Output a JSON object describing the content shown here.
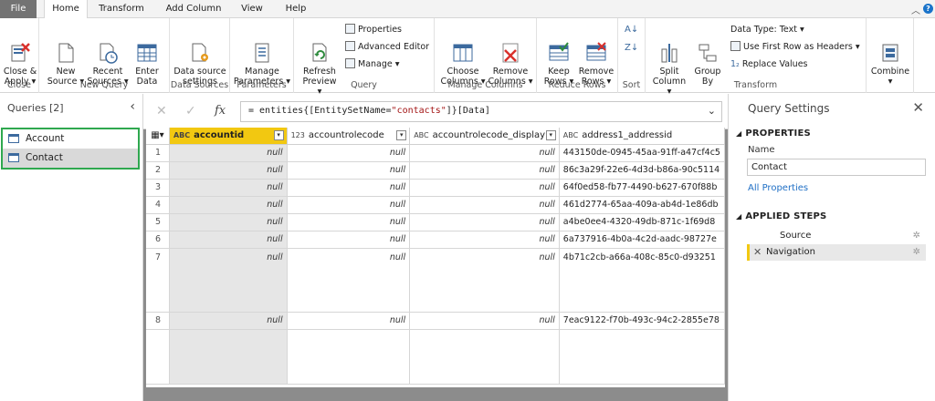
{
  "tabs": [
    "File",
    "Home",
    "Transform",
    "Add Column",
    "View",
    "Help"
  ],
  "active_tab": "Home",
  "ribbon": {
    "close_group": {
      "label": "Close",
      "close_apply": "Close &\nApply ▾"
    },
    "new_query_group": {
      "label": "New Query",
      "new_source": "New\nSource ▾",
      "recent_sources": "Recent\nSources ▾",
      "enter_data": "Enter\nData"
    },
    "data_sources_group": {
      "label": "Data Sources",
      "data_source_settings": "Data source\nsettings"
    },
    "parameters_group": {
      "label": "Parameters",
      "manage_parameters": "Manage\nParameters ▾"
    },
    "query_group": {
      "label": "Query",
      "refresh_preview": "Refresh\nPreview ▾",
      "properties": "Properties",
      "advanced_editor": "Advanced Editor",
      "manage": "Manage ▾"
    },
    "manage_columns_group": {
      "label": "Manage Columns",
      "choose_columns": "Choose\nColumns ▾",
      "remove_columns": "Remove\nColumns ▾"
    },
    "reduce_rows_group": {
      "label": "Reduce Rows",
      "keep_rows": "Keep\nRows ▾",
      "remove_rows": "Remove\nRows ▾"
    },
    "sort_group": {
      "label": "Sort"
    },
    "transform_group": {
      "label": "Transform",
      "split_column": "Split\nColumn ▾",
      "group_by": "Group\nBy",
      "data_type": "Data Type: Text ▾",
      "first_row_headers": "Use First Row as Headers ▾",
      "replace_values": "Replace Values"
    },
    "combine_group": {
      "label": "",
      "combine": "Combine\n▾"
    }
  },
  "queries": {
    "title": "Queries [2]",
    "items": [
      "Account",
      "Contact"
    ],
    "selected": "Contact"
  },
  "formula": {
    "prefix": "= entities{[EntitySetName=",
    "string": "\"contacts\"",
    "suffix": "]}[Data]"
  },
  "grid": {
    "columns": [
      {
        "type": "ABC",
        "name": "accountid"
      },
      {
        "type": "123",
        "name": "accountrolecode"
      },
      {
        "type": "ABC",
        "name": "accountrolecode_display"
      },
      {
        "type": "ABC",
        "name": "address1_addressid"
      }
    ],
    "rows": [
      {
        "n": "1",
        "c1": "null",
        "c2": "null",
        "c3": "null",
        "c4": "443150de-0945-45aa-91ff-a47cf4c5"
      },
      {
        "n": "2",
        "c1": "null",
        "c2": "null",
        "c3": "null",
        "c4": "86c3a29f-22e6-4d3d-b86a-90c5114"
      },
      {
        "n": "3",
        "c1": "null",
        "c2": "null",
        "c3": "null",
        "c4": "64f0ed58-fb77-4490-b627-670f88b"
      },
      {
        "n": "4",
        "c1": "null",
        "c2": "null",
        "c3": "null",
        "c4": "461d2774-65aa-409a-ab4d-1e86db"
      },
      {
        "n": "5",
        "c1": "null",
        "c2": "null",
        "c3": "null",
        "c4": "a4be0ee4-4320-49db-871c-1f69d8"
      },
      {
        "n": "6",
        "c1": "null",
        "c2": "null",
        "c3": "null",
        "c4": "6a737916-4b0a-4c2d-aadc-98727e"
      },
      {
        "n": "7",
        "c1": "null",
        "c2": "null",
        "c3": "null",
        "c4": "4b71c2cb-a66a-408c-85c0-d93251"
      },
      {
        "n": "8",
        "c1": "null",
        "c2": "null",
        "c3": "null",
        "c4": "7eac9122-f70b-493c-94c2-2855e78"
      }
    ]
  },
  "settings": {
    "title": "Query Settings",
    "properties_heading": "PROPERTIES",
    "name_label": "Name",
    "name_value": "Contact",
    "all_properties": "All Properties",
    "steps_heading": "APPLIED STEPS",
    "steps": [
      "Source",
      "Navigation"
    ]
  },
  "colors": {
    "accent": "#f2c811",
    "selection_border": "#2fa84f",
    "file_tab": "#737373",
    "link": "#1f6fc5"
  }
}
